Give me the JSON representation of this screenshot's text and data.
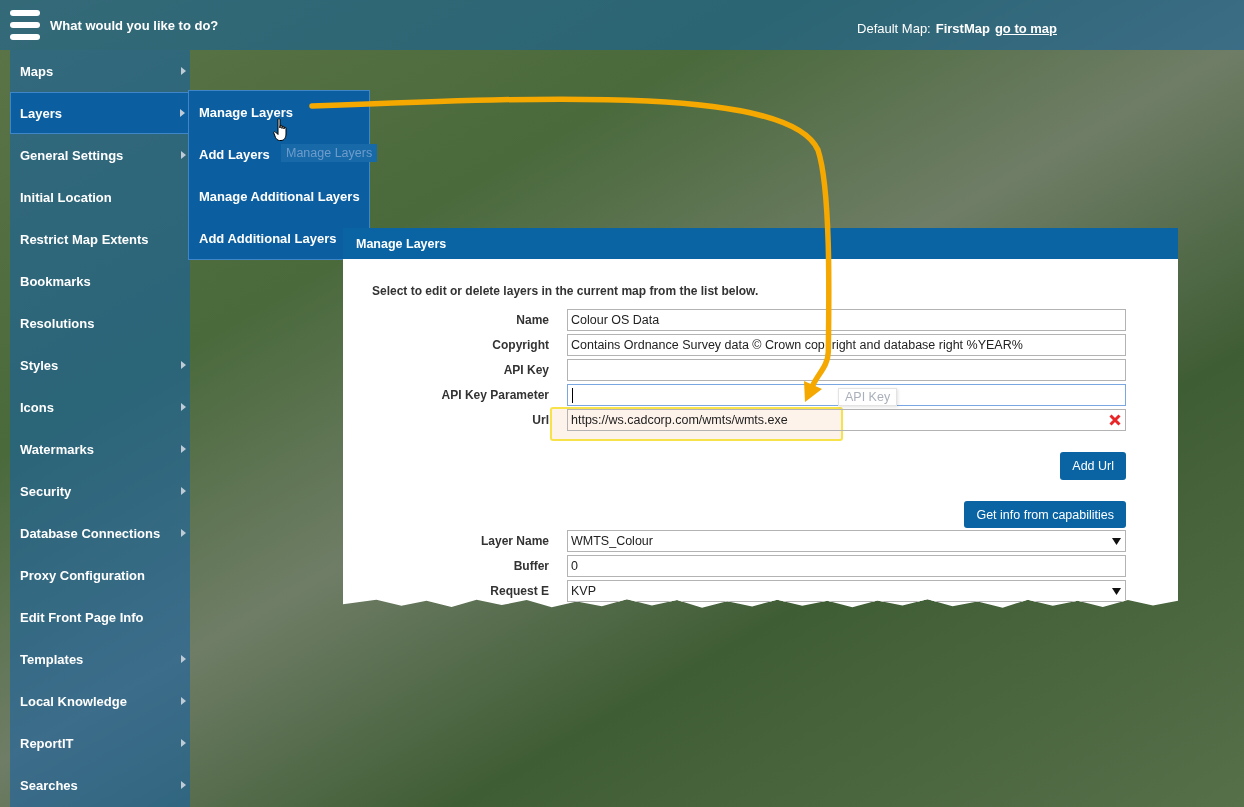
{
  "top_bar": {
    "prompt": "What would you like to do?",
    "default_map_label": "Default Map:",
    "default_map_name": "FirstMap",
    "link": "go to map"
  },
  "sidebar": {
    "items": [
      {
        "label": "Maps",
        "has_submenu": true,
        "selected": false
      },
      {
        "label": "Layers",
        "has_submenu": true,
        "selected": true
      },
      {
        "label": "General Settings",
        "has_submenu": true,
        "selected": false
      },
      {
        "label": "Initial Location",
        "has_submenu": false,
        "selected": false
      },
      {
        "label": "Restrict Map Extents",
        "has_submenu": false,
        "selected": false
      },
      {
        "label": "Bookmarks",
        "has_submenu": false,
        "selected": false
      },
      {
        "label": "Resolutions",
        "has_submenu": false,
        "selected": false
      },
      {
        "label": "Styles",
        "has_submenu": true,
        "selected": false
      },
      {
        "label": "Icons",
        "has_submenu": true,
        "selected": false
      },
      {
        "label": "Watermarks",
        "has_submenu": true,
        "selected": false
      },
      {
        "label": "Security",
        "has_submenu": true,
        "selected": false
      },
      {
        "label": "Database Connections",
        "has_submenu": true,
        "selected": false
      },
      {
        "label": "Proxy Configuration",
        "has_submenu": false,
        "selected": false
      },
      {
        "label": "Edit Front Page Info",
        "has_submenu": false,
        "selected": false
      },
      {
        "label": "Templates",
        "has_submenu": true,
        "selected": false
      },
      {
        "label": "Local Knowledge",
        "has_submenu": true,
        "selected": false
      },
      {
        "label": "ReportIT",
        "has_submenu": true,
        "selected": false
      },
      {
        "label": "Searches",
        "has_submenu": true,
        "selected": false
      }
    ]
  },
  "submenu": {
    "items": [
      {
        "label": "Manage Layers",
        "hovered": true
      },
      {
        "label": "Add Layers",
        "hovered": false
      },
      {
        "label": "Manage Additional Layers",
        "hovered": false
      },
      {
        "label": "Add Additional Layers",
        "hovered": false
      }
    ],
    "tooltip": "Manage Layers"
  },
  "dialog": {
    "title": "Manage Layers",
    "instruction": "Select to edit or delete layers in the current map from the list below.",
    "fields": [
      {
        "label": "Name",
        "kind": "text",
        "value": "Colour OS Data",
        "focused": false,
        "highlighted": false
      },
      {
        "label": "Copyright",
        "kind": "text",
        "value": "Contains Ordnance Survey data © Crown cop  right and database right %YEAR%",
        "focused": false,
        "highlighted": false
      },
      {
        "label": "API Key",
        "kind": "text",
        "focused": false,
        "highlighted": false
      },
      {
        "label": "API Key Parameter",
        "kind": "text",
        "focused": true,
        "highlighted": false,
        "tooltip": "API Key"
      },
      {
        "label": "Url",
        "kind": "url",
        "value": "https://ws.cadcorp.com/wmts/wmts.exe",
        "focused": false,
        "highlighted": true
      }
    ],
    "add_button": "Add Url",
    "capabilities_button": "Get info from capabilities",
    "layer_fields": [
      {
        "label": "Layer Name",
        "kind": "select",
        "value": "WMTS_Colour",
        "focused": false,
        "highlighted": false
      },
      {
        "label": "Buffer",
        "kind": "text",
        "value": "0",
        "focused": false,
        "highlighted": false
      },
      {
        "label": "Request E",
        "kind": "select",
        "value": "KVP",
        "focused": false,
        "highlighted": false
      }
    ]
  }
}
